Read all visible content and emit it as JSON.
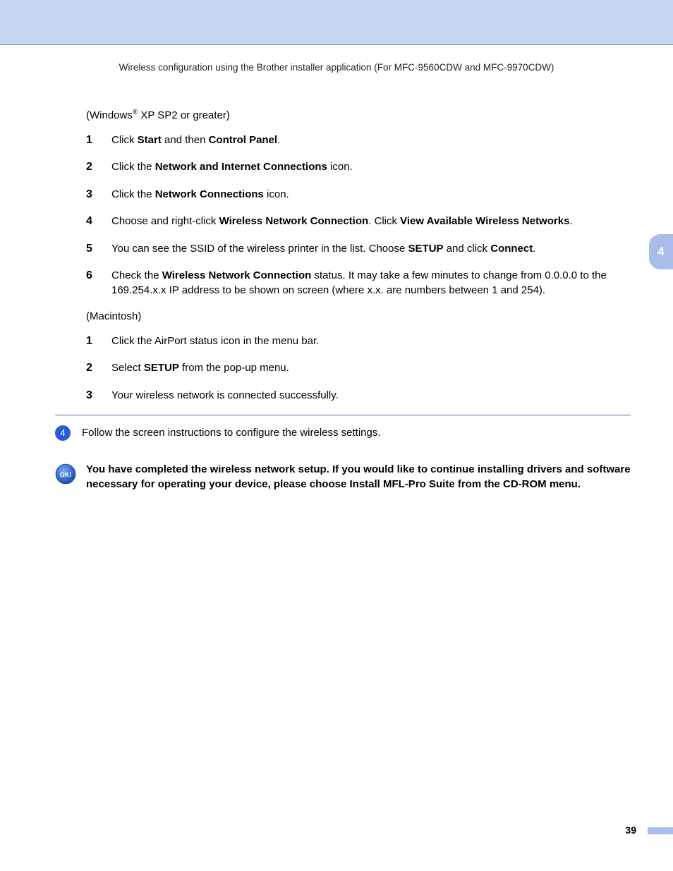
{
  "header": "Wireless configuration using the Brother installer application (For MFC-9560CDW and MFC-9970CDW)",
  "sideTab": "4",
  "pageNumber": "39",
  "windows": {
    "label_pre": "(Windows",
    "reg": "®",
    "label_post": " XP SP2 or greater)",
    "steps": [
      {
        "n": "1",
        "parts": [
          "Click ",
          {
            "b": "Start"
          },
          " and then ",
          {
            "b": "Control Panel"
          },
          "."
        ]
      },
      {
        "n": "2",
        "parts": [
          "Click the ",
          {
            "b": "Network and Internet Connections"
          },
          " icon."
        ]
      },
      {
        "n": "3",
        "parts": [
          "Click the ",
          {
            "b": "Network Connections"
          },
          " icon."
        ]
      },
      {
        "n": "4",
        "parts": [
          "Choose and right-click ",
          {
            "b": "Wireless Network Connection"
          },
          ". Click ",
          {
            "b": "View Available Wireless Networks"
          },
          "."
        ]
      },
      {
        "n": "5",
        "parts": [
          "You can see the SSID of the wireless printer in the list. Choose ",
          {
            "b": "SETUP"
          },
          " and click ",
          {
            "b": "Connect"
          },
          "."
        ]
      },
      {
        "n": "6",
        "parts": [
          "Check the ",
          {
            "b": "Wireless Network Connection"
          },
          " status. It may take a few minutes to change from 0.0.0.0 to the 169.254.x.x IP address to be shown on screen (where x.x. are numbers between 1 and 254)."
        ]
      }
    ]
  },
  "mac": {
    "label": "(Macintosh)",
    "steps": [
      {
        "n": "1",
        "parts": [
          "Click the AirPort status icon in the menu bar."
        ]
      },
      {
        "n": "2",
        "parts": [
          "Select ",
          {
            "b": "SETUP"
          },
          " from the pop-up menu."
        ]
      },
      {
        "n": "3",
        "parts": [
          "Your wireless network is connected successfully."
        ]
      }
    ]
  },
  "bigStep": {
    "num": "4",
    "text": "Follow the screen instructions to configure the wireless settings."
  },
  "ok": {
    "label": "OK!",
    "text": "You have completed the wireless network setup. If you would like to continue installing drivers and software necessary for operating your device, please choose Install MFL-Pro Suite from the CD-ROM menu."
  }
}
